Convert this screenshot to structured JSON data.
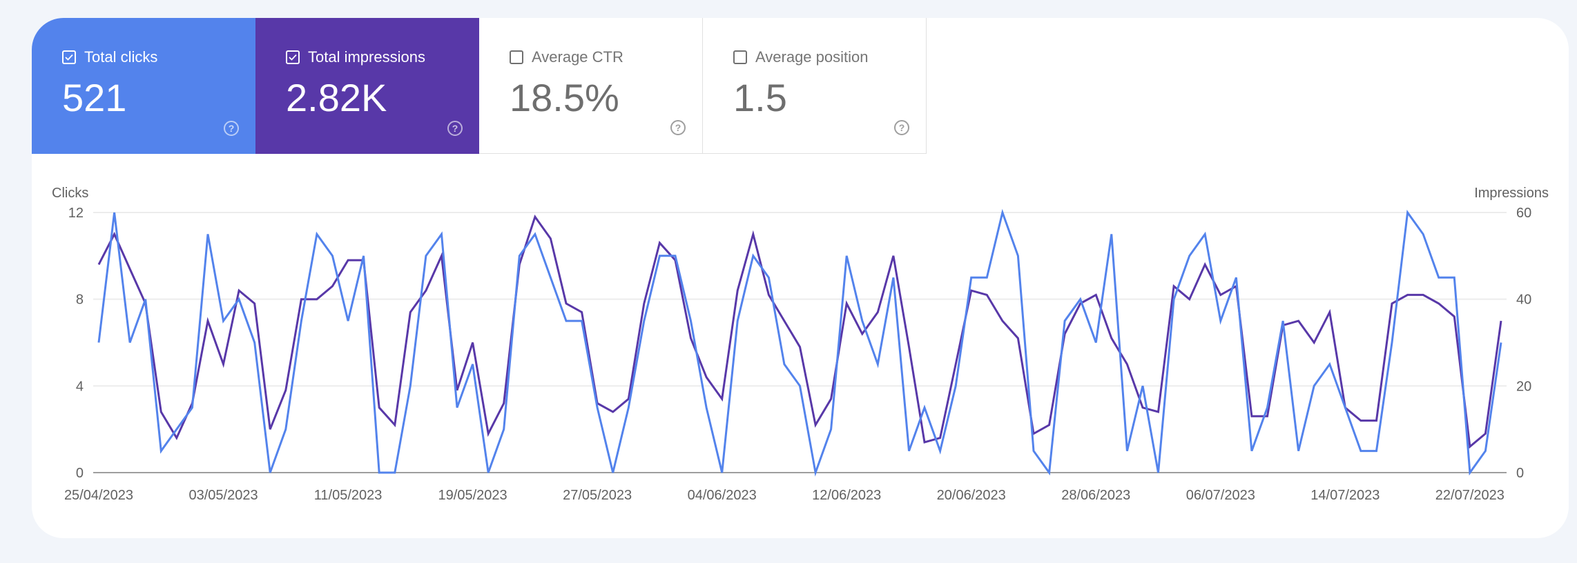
{
  "metrics": [
    {
      "label": "Total clicks",
      "value": "521",
      "checked": true,
      "color": "#5383ec"
    },
    {
      "label": "Total impressions",
      "value": "2.82K",
      "checked": true,
      "color": "#5838a8"
    },
    {
      "label": "Average CTR",
      "value": "18.5%",
      "checked": false
    },
    {
      "label": "Average position",
      "value": "1.5",
      "checked": false
    }
  ],
  "chart_data": {
    "type": "line",
    "title": "",
    "left_axis": {
      "label": "Clicks",
      "ticks": [
        "0",
        "4",
        "8",
        "12"
      ],
      "range": [
        0,
        12
      ]
    },
    "right_axis": {
      "label": "Impressions",
      "ticks": [
        "0",
        "20",
        "40",
        "60"
      ],
      "range": [
        0,
        60
      ]
    },
    "x_tick_labels": [
      "25/04/2023",
      "03/05/2023",
      "11/05/2023",
      "19/05/2023",
      "27/05/2023",
      "04/06/2023",
      "12/06/2023",
      "20/06/2023",
      "28/06/2023",
      "06/07/2023",
      "14/07/2023",
      "22/07/2023"
    ],
    "x_start": "25/04/2023",
    "x_end": "23/07/2023",
    "grid": true,
    "series": [
      {
        "name": "Clicks",
        "axis": "left",
        "color": "#5383ec",
        "values": [
          6,
          12,
          6,
          8,
          1,
          2,
          3,
          11,
          7,
          8,
          6,
          0,
          2,
          7,
          11,
          10,
          7,
          10,
          0,
          0,
          4,
          10,
          11,
          3,
          5,
          0,
          2,
          10,
          11,
          9,
          7,
          7,
          3,
          0,
          3,
          7,
          10,
          10,
          7,
          3,
          0,
          7,
          10,
          9,
          5,
          4,
          0,
          2,
          10,
          7,
          5,
          9,
          1,
          3,
          1,
          4,
          9,
          9,
          12,
          10,
          1,
          0,
          7,
          8,
          6,
          11,
          1,
          4,
          0,
          8,
          10,
          11,
          7,
          9,
          1,
          3,
          7,
          1,
          4,
          5,
          3,
          1,
          1,
          6,
          12,
          11,
          9,
          9,
          0,
          1,
          6
        ]
      },
      {
        "name": "Impressions",
        "axis": "right",
        "color": "#5838a8",
        "values": [
          48,
          55,
          47,
          39,
          14,
          8,
          16,
          35,
          25,
          42,
          39,
          10,
          19,
          40,
          40,
          43,
          49,
          49,
          15,
          11,
          37,
          42,
          50,
          19,
          30,
          9,
          16,
          48,
          59,
          54,
          39,
          37,
          16,
          14,
          17,
          39,
          53,
          49,
          31,
          22,
          17,
          42,
          55,
          41,
          35,
          29,
          11,
          17,
          39,
          32,
          37,
          50,
          29,
          7,
          8,
          25,
          42,
          41,
          35,
          31,
          9,
          11,
          32,
          39,
          41,
          31,
          25,
          15,
          14,
          43,
          40,
          48,
          41,
          43,
          13,
          13,
          34,
          35,
          30,
          37,
          15,
          12,
          12,
          39,
          41,
          41,
          39,
          36,
          6,
          9,
          35
        ]
      }
    ]
  }
}
